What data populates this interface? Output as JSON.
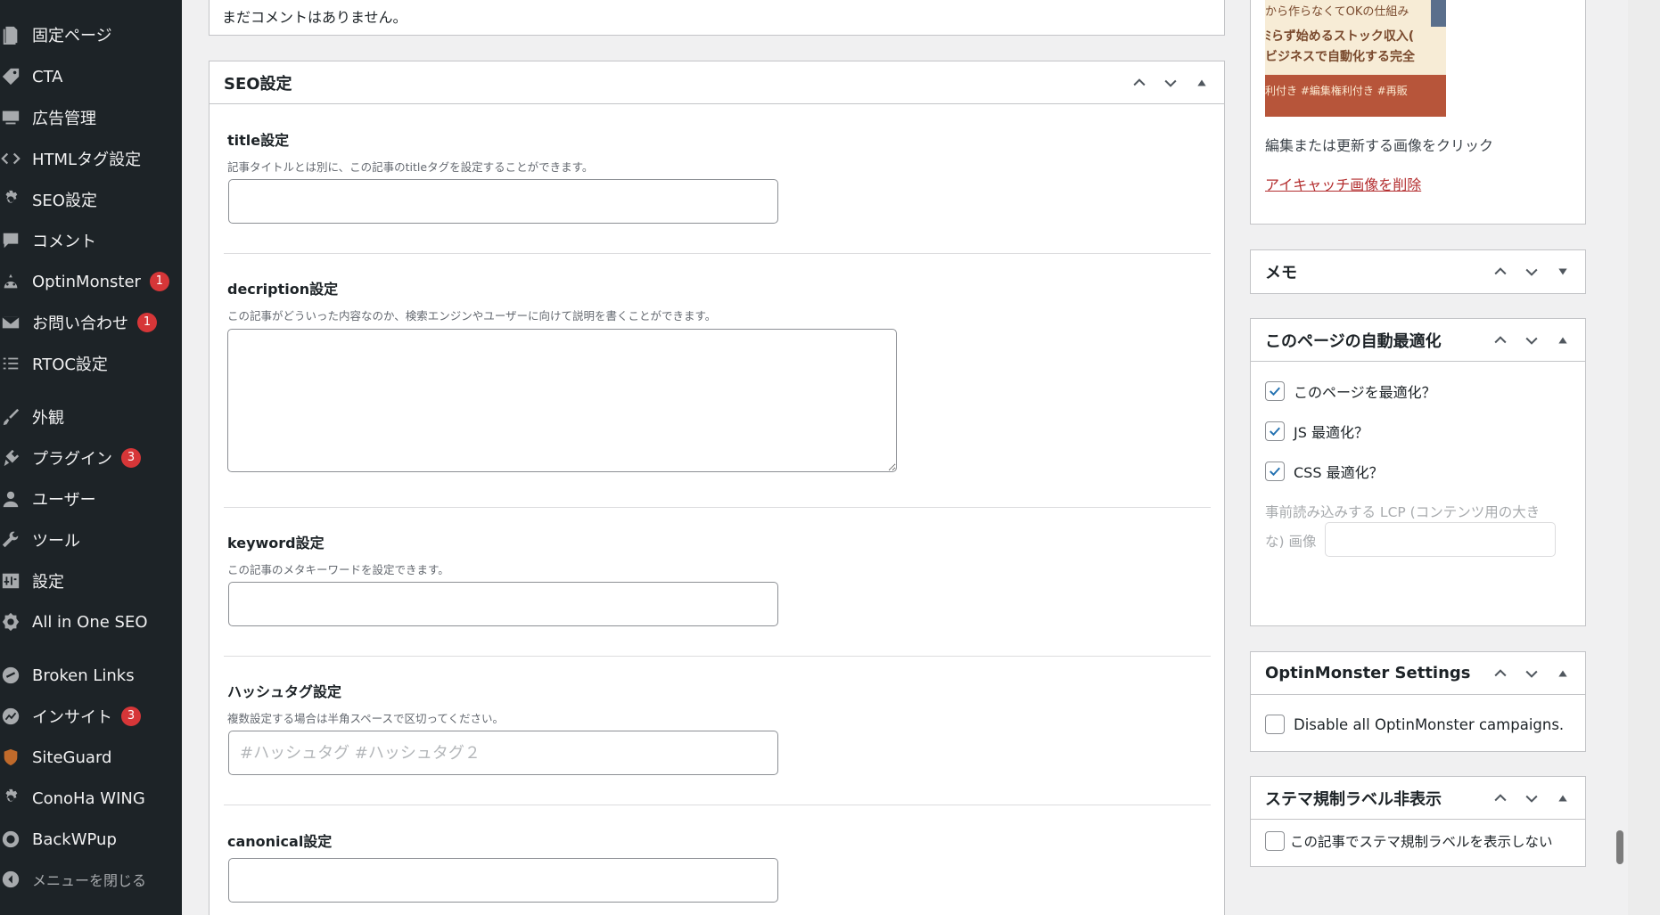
{
  "sidebar": {
    "items": [
      {
        "label": "固定ページ",
        "icon": "pages-icon",
        "badge": ""
      },
      {
        "label": "CTA",
        "icon": "tag-icon",
        "badge": ""
      },
      {
        "label": "広告管理",
        "icon": "ads-icon",
        "badge": ""
      },
      {
        "label": "HTMLタグ設定",
        "icon": "code-icon",
        "badge": ""
      },
      {
        "label": "SEO設定",
        "icon": "gear-icon",
        "badge": ""
      },
      {
        "label": "コメント",
        "icon": "comment-icon",
        "badge": ""
      },
      {
        "label": "OptinMonster",
        "icon": "monster-icon",
        "badge": "1"
      },
      {
        "label": "お問い合わせ",
        "icon": "mail-icon",
        "badge": "1"
      },
      {
        "label": "RTOC設定",
        "icon": "list-icon",
        "badge": ""
      },
      {
        "label": "外観",
        "icon": "brush-icon",
        "badge": ""
      },
      {
        "label": "プラグイン",
        "icon": "plugin-icon",
        "badge": "3"
      },
      {
        "label": "ユーザー",
        "icon": "user-icon",
        "badge": ""
      },
      {
        "label": "ツール",
        "icon": "wrench-icon",
        "badge": ""
      },
      {
        "label": "設定",
        "icon": "settings-icon",
        "badge": ""
      },
      {
        "label": "All in One SEO",
        "icon": "aioseo-icon",
        "badge": ""
      },
      {
        "label": "Broken Links",
        "icon": "broken-link-icon",
        "badge": ""
      },
      {
        "label": "インサイト",
        "icon": "insights-icon",
        "badge": "3"
      },
      {
        "label": "SiteGuard",
        "icon": "shield-icon",
        "badge": ""
      },
      {
        "label": "ConoHa WING",
        "icon": "gear-icon",
        "badge": ""
      },
      {
        "label": "BackWPup",
        "icon": "backup-icon",
        "badge": ""
      }
    ],
    "collapse_label": "メニューを閉じる"
  },
  "comments": {
    "empty_text": "まだコメントはありません。"
  },
  "seo_box": {
    "title": "SEO設定",
    "fields": {
      "title": {
        "label": "title設定",
        "desc": "記事タイトルとは別に、この記事のtitleタグを設定することができます。",
        "value": ""
      },
      "description": {
        "label": "decription設定",
        "desc": "この記事がどういった内容なのか、検索エンジンやユーザーに向けて説明を書くことができます。",
        "value": ""
      },
      "keyword": {
        "label": "keyword設定",
        "desc": "この記事のメタキーワードを設定できます。",
        "value": ""
      },
      "hashtag": {
        "label": "ハッシュタグ設定",
        "desc": "複数設定する場合は半角スペースで区切ってください。",
        "placeholder": "#ハッシュタグ #ハッシュタグ２",
        "value": ""
      },
      "canonical": {
        "label": "canonical設定",
        "value": ""
      }
    }
  },
  "featured_image": {
    "thumb_lines": [
      "から作らなくてOKの仕組み",
      "ﾐらず始めるストック収入(",
      "ビジネスで自動化する完全",
      "利付き  #編集権利付き  #再販"
    ],
    "hint": "編集または更新する画像をクリック",
    "remove_link": "アイキャッチ画像を削除"
  },
  "memo_box": {
    "title": "メモ"
  },
  "optimize_box": {
    "title": "このページの自動最適化",
    "options": [
      {
        "label": "このページを最適化？",
        "checked": true
      },
      {
        "label": "JS 最適化？",
        "checked": true
      },
      {
        "label": "CSS 最適化？",
        "checked": true
      }
    ],
    "lcp_label_1": "事前読み込みする LCP (コンテンツ用の大き",
    "lcp_label_2": "な) 画像",
    "lcp_value": ""
  },
  "optinmonster_box": {
    "title": "OptinMonster Settings",
    "option": "Disable all OptinMonster campaigns.",
    "checked": false
  },
  "stealth_box": {
    "title": "ステマ規制ラベル非表示",
    "option": "この記事でステマ規制ラベルを表示しない",
    "checked": false
  },
  "colors": {
    "sidebar_bg": "#1d2327",
    "badge": "#d63638",
    "link_red": "#b32d2e",
    "check_blue": "#2271b1"
  }
}
